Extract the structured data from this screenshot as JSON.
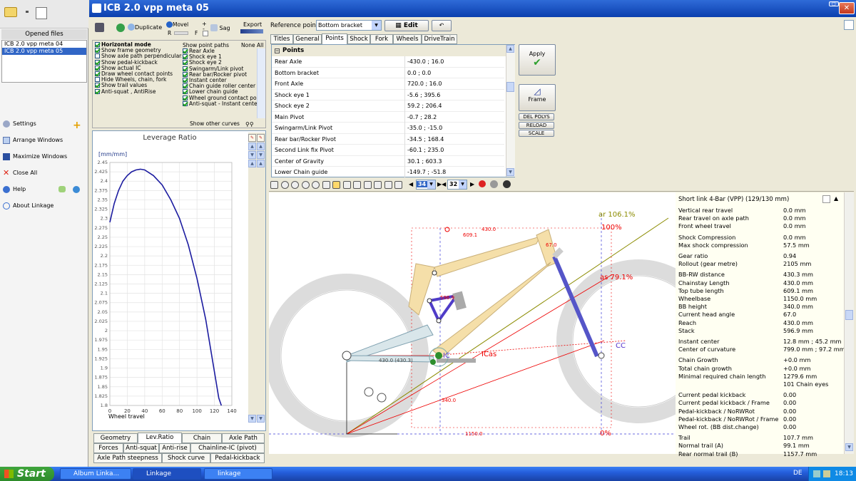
{
  "left": {
    "opened_files_title": "Opened files",
    "files": [
      "ICB 2.0 vpp meta 04",
      "ICB 2.0 vpp meta 05"
    ],
    "menu": [
      {
        "label": "Settings",
        "icon": "gear-icon"
      },
      {
        "label": "Arrange Windows",
        "icon": "arrange-icon"
      },
      {
        "label": "Maximize Windows",
        "icon": "maximize-icon"
      },
      {
        "label": "Close All",
        "icon": "close-icon"
      },
      {
        "label": "Help",
        "icon": "help-icon"
      },
      {
        "label": "About Linkage",
        "icon": "info-icon"
      }
    ]
  },
  "window": {
    "title": "ICB 2.0 vpp meta 05"
  },
  "toolbar": {
    "duplicate": "Duplicate",
    "movel": "Movel",
    "r": "R",
    "f": "F",
    "sag": "Sag",
    "export": "Export",
    "plus": "+",
    "minus": "-"
  },
  "options": [
    {
      "label": "Horizontal mode",
      "on": true
    },
    {
      "label": "Show frame geometry",
      "on": true
    },
    {
      "label": "Show axle path perpendiculars",
      "on": false
    },
    {
      "label": "Show pedal-kickback",
      "on": true
    },
    {
      "label": "Show actual IC",
      "on": true
    },
    {
      "label": "Draw wheel contact points",
      "on": true
    },
    {
      "label": "Hide Wheels, chain, fork",
      "on": false
    },
    {
      "label": "Show trail values",
      "on": true
    },
    {
      "label": "Anti-squat , AntiRise",
      "on": true
    }
  ],
  "point_paths": {
    "header": "Show point paths",
    "none": "None",
    "all": "All",
    "items": [
      "Rear Axle",
      "Shock eye 1",
      "Shock eye 2",
      "Swingarm/Link pivot",
      "Rear bar/Rocker pivot",
      "Instant center",
      "Chain guide roller center",
      "Lower chain guide",
      "Wheel ground contact po",
      "Anti-squat - Instant cente"
    ],
    "other": "Show other curves"
  },
  "reference": {
    "label": "Reference point",
    "value": "Bottom bracket",
    "edit": "Edit"
  },
  "tabs": [
    "Titles",
    "General",
    "Points",
    "Shock",
    "Fork",
    "Wheels",
    "DriveTrain"
  ],
  "active_tab": "Points",
  "points_header": "Points",
  "points": [
    {
      "name": "Rear Axle",
      "value": "-430.0 ; 16.0"
    },
    {
      "name": "Bottom bracket",
      "value": "0.0 ; 0.0"
    },
    {
      "name": "Front Axle",
      "value": "720.0 ; 16.0"
    },
    {
      "name": "Shock eye 1",
      "value": "-5.6 ; 395.6"
    },
    {
      "name": "Shock eye 2",
      "value": "59.2 ; 206.4"
    },
    {
      "name": "Main Pivot",
      "value": "-0.7 ; 28.2"
    },
    {
      "name": "Swingarm/Link Pivot",
      "value": "-35.0 ; -15.0"
    },
    {
      "name": "Rear bar/Rocker Pivot",
      "value": "-34.5 ; 168.4"
    },
    {
      "name": "Second Link fix Pivot",
      "value": "-60.1 ; 235.0"
    },
    {
      "name": "Center of Gravity",
      "value": "30.1 ; 603.3"
    },
    {
      "name": "Lower Chain guide",
      "value": "-149.7 ; -51.8"
    }
  ],
  "side_buttons": {
    "apply": "Apply",
    "frame": "Frame",
    "del_polys": "DEL POLYS",
    "reload": "RELOAD",
    "scale": "SCALE"
  },
  "nav": {
    "left_value": "34",
    "right_value": "32"
  },
  "chart_data": {
    "type": "line",
    "title": "Leverage Ratio",
    "ylabel": "[mm/mm]",
    "xlabel": "Wheel travel",
    "xlim": [
      0,
      140
    ],
    "ylim": [
      1.8,
      2.45
    ],
    "xticks": [
      0,
      20,
      40,
      60,
      80,
      100,
      120,
      140
    ],
    "yticks": [
      1.8,
      1.825,
      1.85,
      1.875,
      1.9,
      1.925,
      1.95,
      1.975,
      2,
      2.025,
      2.05,
      2.075,
      2.1,
      2.125,
      2.15,
      2.175,
      2.2,
      2.225,
      2.25,
      2.275,
      2.3,
      2.325,
      2.35,
      2.375,
      2.4,
      2.425,
      2.45
    ],
    "series": [
      {
        "x": [
          0,
          5,
          10,
          15,
          20,
          25,
          30,
          35,
          40,
          50,
          60,
          70,
          80,
          90,
          100,
          110,
          115,
          120,
          125,
          128
        ],
        "y": [
          2.29,
          2.34,
          2.375,
          2.4,
          2.415,
          2.425,
          2.43,
          2.432,
          2.43,
          2.415,
          2.39,
          2.35,
          2.3,
          2.23,
          2.14,
          2.03,
          1.96,
          1.89,
          1.82,
          1.8
        ]
      }
    ]
  },
  "chart_tabs_row1": [
    "Geometry",
    "Lev.Ratio",
    "Chain",
    "Axle Path"
  ],
  "chart_tabs_row2": [
    "Forces",
    "Anti-squat",
    "Anti-rise",
    "Chainline-IC (pivot) offset"
  ],
  "chart_tabs_row3": [
    "Axle Path steepness",
    "Shock curve",
    "Pedal-kickback"
  ],
  "drawing": {
    "ar_label": "ar 106.1%",
    "as_label": "as 79.1%",
    "pct100": "100%",
    "pct0": "0%",
    "ic": "IC",
    "icas": "ICas",
    "cc": "CC",
    "dims": [
      "609.1",
      "430.0",
      "67.0",
      "596.9",
      "430.0 (430.3)",
      "340.0",
      "1150.0"
    ]
  },
  "info": {
    "title": "Short link 4-Bar (VPP) (129/130 mm)",
    "rows": [
      {
        "k": "Vertical rear travel",
        "v": "0.0 mm"
      },
      {
        "k": "Rear travel on axle path",
        "v": "0.0 mm"
      },
      {
        "k": "Front wheel travel",
        "v": "0.0 mm"
      },
      {
        "k": "Shock Compression",
        "v": "0.0 mm"
      },
      {
        "k": "Max shock compression",
        "v": "57.5 mm"
      },
      {
        "k": "Gear ratio",
        "v": "0.94"
      },
      {
        "k": "Rollout (gear metre)",
        "v": "2105 mm"
      },
      {
        "k": "BB-RW distance",
        "v": "430.3 mm"
      },
      {
        "k": "Chainstay Length",
        "v": "430.0 mm"
      },
      {
        "k": "Top tube length",
        "v": "609.1 mm"
      },
      {
        "k": "Wheelbase",
        "v": "1150.0 mm"
      },
      {
        "k": "BB height",
        "v": "340.0 mm"
      },
      {
        "k": "Current head angle",
        "v": "67.0"
      },
      {
        "k": "Reach",
        "v": "430.0 mm"
      },
      {
        "k": "Stack",
        "v": "596.9 mm"
      },
      {
        "k": "Instant center",
        "v": "12.8 mm ; 45.2 mm"
      },
      {
        "k": "Center of curvature",
        "v": "799.0 mm ; 97.2 mm"
      },
      {
        "k": "Chain Growth",
        "v": "+0.0 mm"
      },
      {
        "k": "Total chain growth",
        "v": "+0.0 mm"
      },
      {
        "k": "Minimal required chain length",
        "v": "1279.6 mm"
      },
      {
        "k": "",
        "v": "101 Chain eyes"
      },
      {
        "k": "Current pedal kickback",
        "v": "0.00"
      },
      {
        "k": "Current pedal kickback / Frame",
        "v": "0.00"
      },
      {
        "k": "Pedal-kickback / NoRWRot",
        "v": "0.00"
      },
      {
        "k": "Pedal-kickback / NoRWRot / Frame",
        "v": "0.00"
      },
      {
        "k": "Wheel rot. (BB dist.change)",
        "v": "0.00"
      },
      {
        "k": "Trail",
        "v": "107.7 mm"
      },
      {
        "k": "Normal trail (A)",
        "v": "99.1 mm"
      },
      {
        "k": "Rear normal trail (B)",
        "v": "1157.7 mm"
      }
    ]
  },
  "taskbar": {
    "start": "Start",
    "tasks": [
      "Album Linka...",
      "Linkage",
      "linkage"
    ],
    "lang": "DE",
    "time": "18:13"
  }
}
